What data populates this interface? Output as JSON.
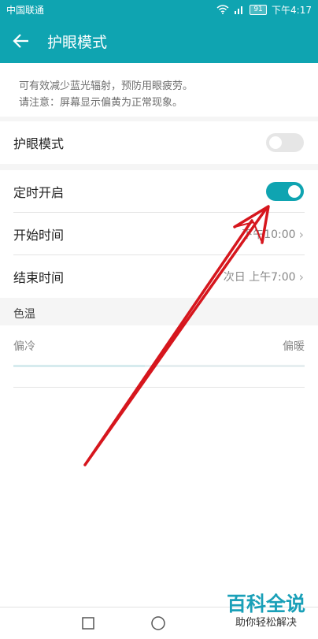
{
  "status_bar": {
    "carrier": "中国联通",
    "battery": "91",
    "time": "下午4:17"
  },
  "app_bar": {
    "title": "护眼模式"
  },
  "description": {
    "line1": "可有效减少蓝光辐射，预防用眼疲劳。",
    "line2": "请注意：屏幕显示偏黄为正常现象。"
  },
  "eye_mode": {
    "label": "护眼模式",
    "enabled": false
  },
  "schedule": {
    "label": "定时开启",
    "enabled": true,
    "start": {
      "label": "开始时间",
      "value": "下午10:00"
    },
    "end": {
      "label": "结束时间",
      "value": "次日 上午7:00"
    }
  },
  "color_temp": {
    "header": "色温",
    "cold_label": "偏冷",
    "warm_label": "偏暖",
    "level": 0.45
  },
  "watermark": {
    "big": "百科全说",
    "small": "助你轻松解决"
  },
  "colors": {
    "accent": "#0fa4b1",
    "arrow": "#d6161d"
  }
}
